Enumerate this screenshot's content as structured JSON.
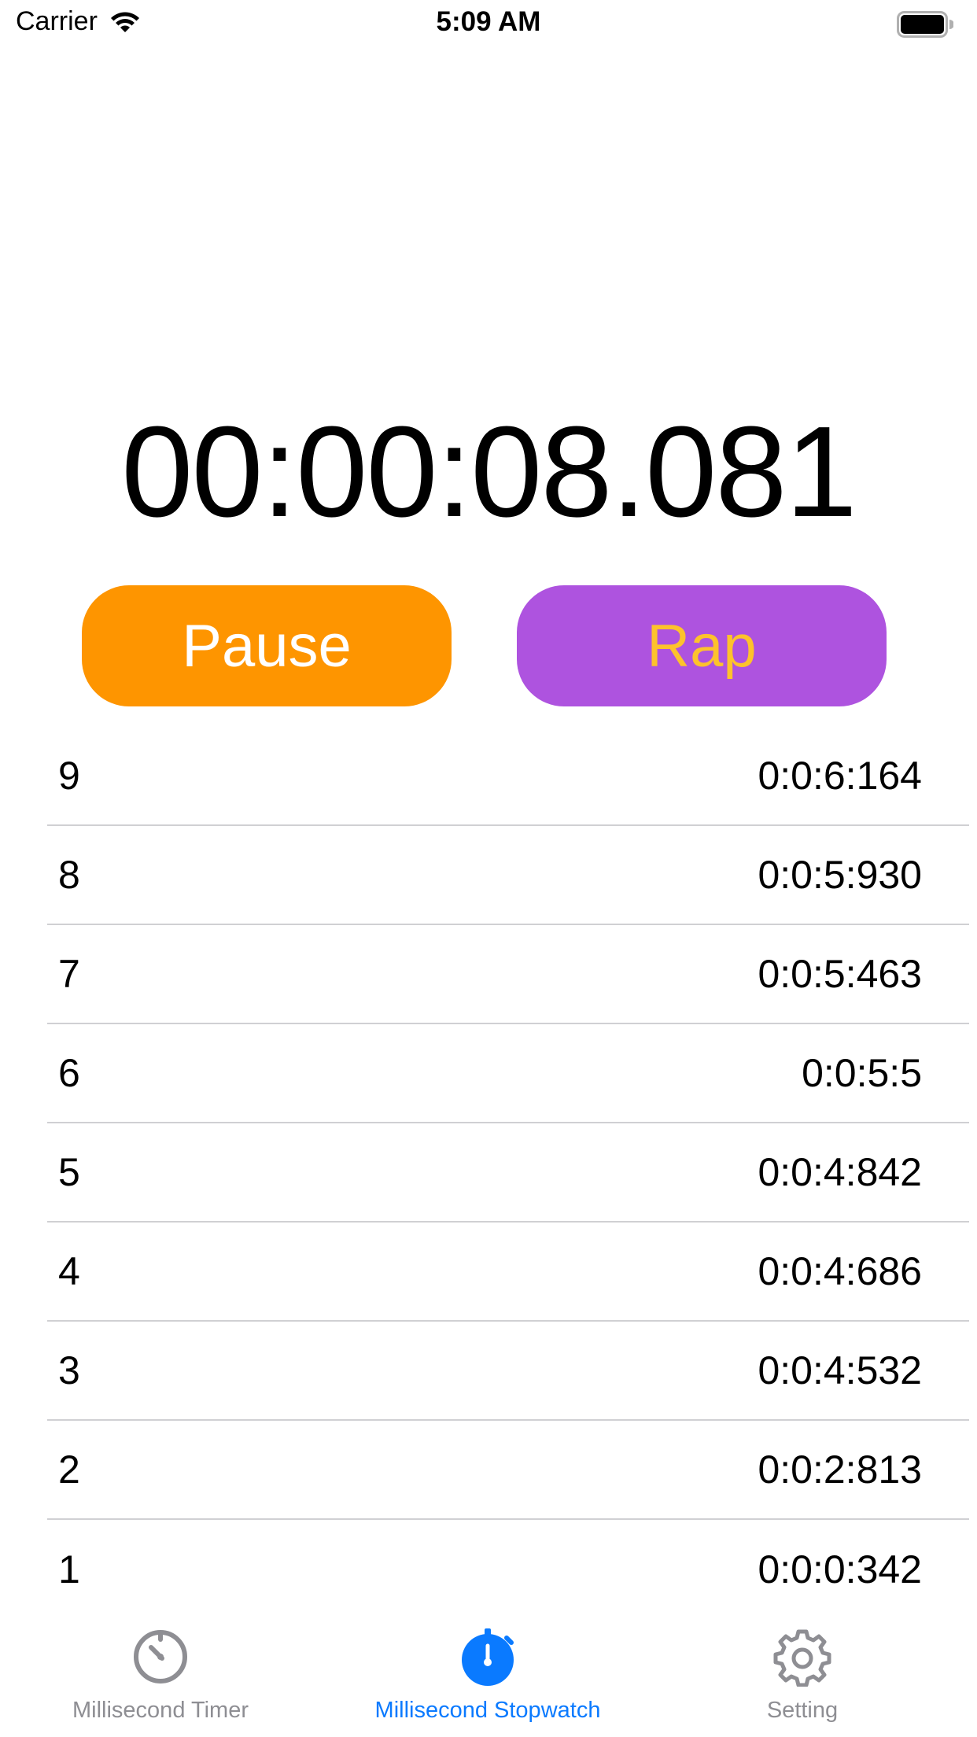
{
  "status_bar": {
    "carrier": "Carrier",
    "time": "5:09 AM"
  },
  "stopwatch": {
    "elapsed": "00:00:08.081",
    "pause_label": "Pause",
    "rap_label": "Rap"
  },
  "laps": [
    {
      "number": "9",
      "time": "0:0:6:164"
    },
    {
      "number": "8",
      "time": "0:0:5:930"
    },
    {
      "number": "7",
      "time": "0:0:5:463"
    },
    {
      "number": "6",
      "time": "0:0:5:5"
    },
    {
      "number": "5",
      "time": "0:0:4:842"
    },
    {
      "number": "4",
      "time": "0:0:4:686"
    },
    {
      "number": "3",
      "time": "0:0:4:532"
    },
    {
      "number": "2",
      "time": "0:0:2:813"
    },
    {
      "number": "1",
      "time": "0:0:0:342"
    }
  ],
  "tab_bar": {
    "tabs": [
      {
        "label": "Millisecond Timer",
        "icon": "timer-icon",
        "active": false
      },
      {
        "label": "Millisecond Stopwatch",
        "icon": "stopwatch-icon",
        "active": true
      },
      {
        "label": "Setting",
        "icon": "gear-icon",
        "active": false
      }
    ]
  },
  "colors": {
    "pause_bg": "#fe9500",
    "pause_text": "#ffffff",
    "rap_bg": "#ae53df",
    "rap_text": "#fdc22c",
    "tab_active": "#0a7aff",
    "tab_inactive": "#8e8e93"
  }
}
